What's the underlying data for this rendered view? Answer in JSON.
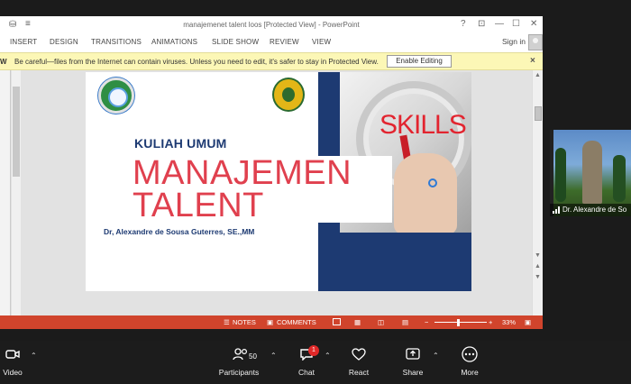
{
  "powerpoint": {
    "title": "manajemenet talent loos [Protected View] - PowerPoint",
    "window_controls": [
      "?",
      "⊡",
      "—",
      "☐",
      "✕"
    ],
    "ribbon_tabs": [
      "INSERT",
      "DESIGN",
      "TRANSITIONS",
      "ANIMATIONS",
      "SLIDE SHOW",
      "REVIEW",
      "VIEW"
    ],
    "sign_in": "Sign in",
    "protected_view": {
      "label": "W",
      "message": "Be careful—files from the Internet can contain viruses. Unless you need to edit, it's safer to stay in Protected View.",
      "enable_button": "Enable Editing",
      "close": "×"
    },
    "status_bar": {
      "notes": "NOTES",
      "comments": "COMMENTS",
      "zoom_minus": "−",
      "zoom_plus": "+",
      "zoom_level": "33%"
    }
  },
  "slide": {
    "heading": "KULIAH UMUM",
    "title_line1": "MANAJEMEN",
    "title_line2": "TALENT",
    "author": "Dr, Alexandre de Sousa Guterres, SE.,MM",
    "image_word": "SKILLS"
  },
  "participant_video": {
    "name": "Dr. Alexandre de So"
  },
  "zoom_toolbar": {
    "video": "Video",
    "participants": "Participants",
    "participants_count": "50",
    "chat": "Chat",
    "chat_badge": "1",
    "react": "React",
    "share": "Share",
    "more": "More"
  },
  "colors": {
    "navy": "#1d3a72",
    "title_red": "#e0404e",
    "status_orange": "#d0442c",
    "protected_yellow": "#fcf7b6"
  }
}
